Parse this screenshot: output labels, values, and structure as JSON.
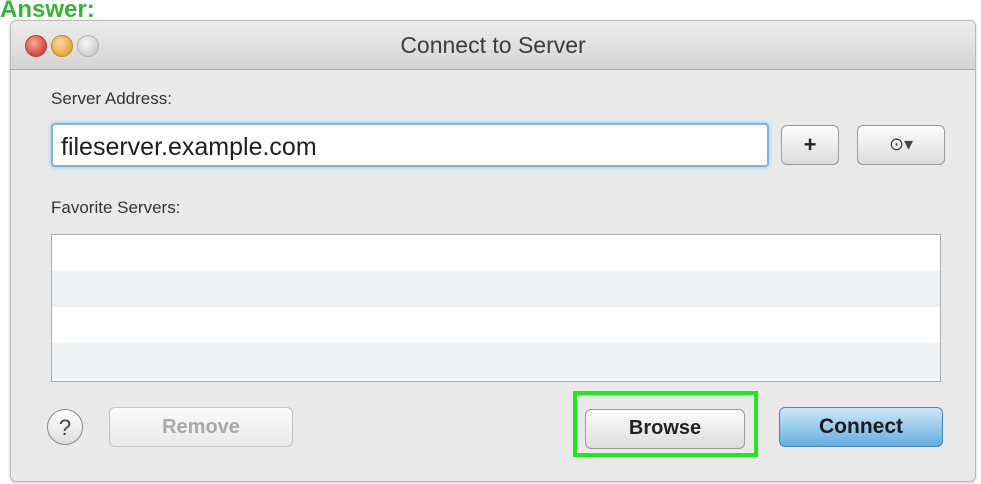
{
  "annotation": {
    "label": "Answer:"
  },
  "window": {
    "title": "Connect to Server"
  },
  "form": {
    "server_address_label": "Server Address:",
    "server_address_value": "fileserver.example.com",
    "favorite_servers_label": "Favorite Servers:"
  },
  "buttons": {
    "add_label": "+",
    "action_label": "⊙▾",
    "help_label": "?",
    "remove_label": "Remove",
    "browse_label": "Browse",
    "connect_label": "Connect"
  },
  "favorites": {
    "items": [
      "",
      "",
      "",
      ""
    ]
  },
  "colors": {
    "highlight": "#23e523",
    "default_button": "#63aee0",
    "focus_ring": "#7fb5dc"
  },
  "icons": {
    "help": "question-mark-icon",
    "action": "action-gear-icon"
  }
}
